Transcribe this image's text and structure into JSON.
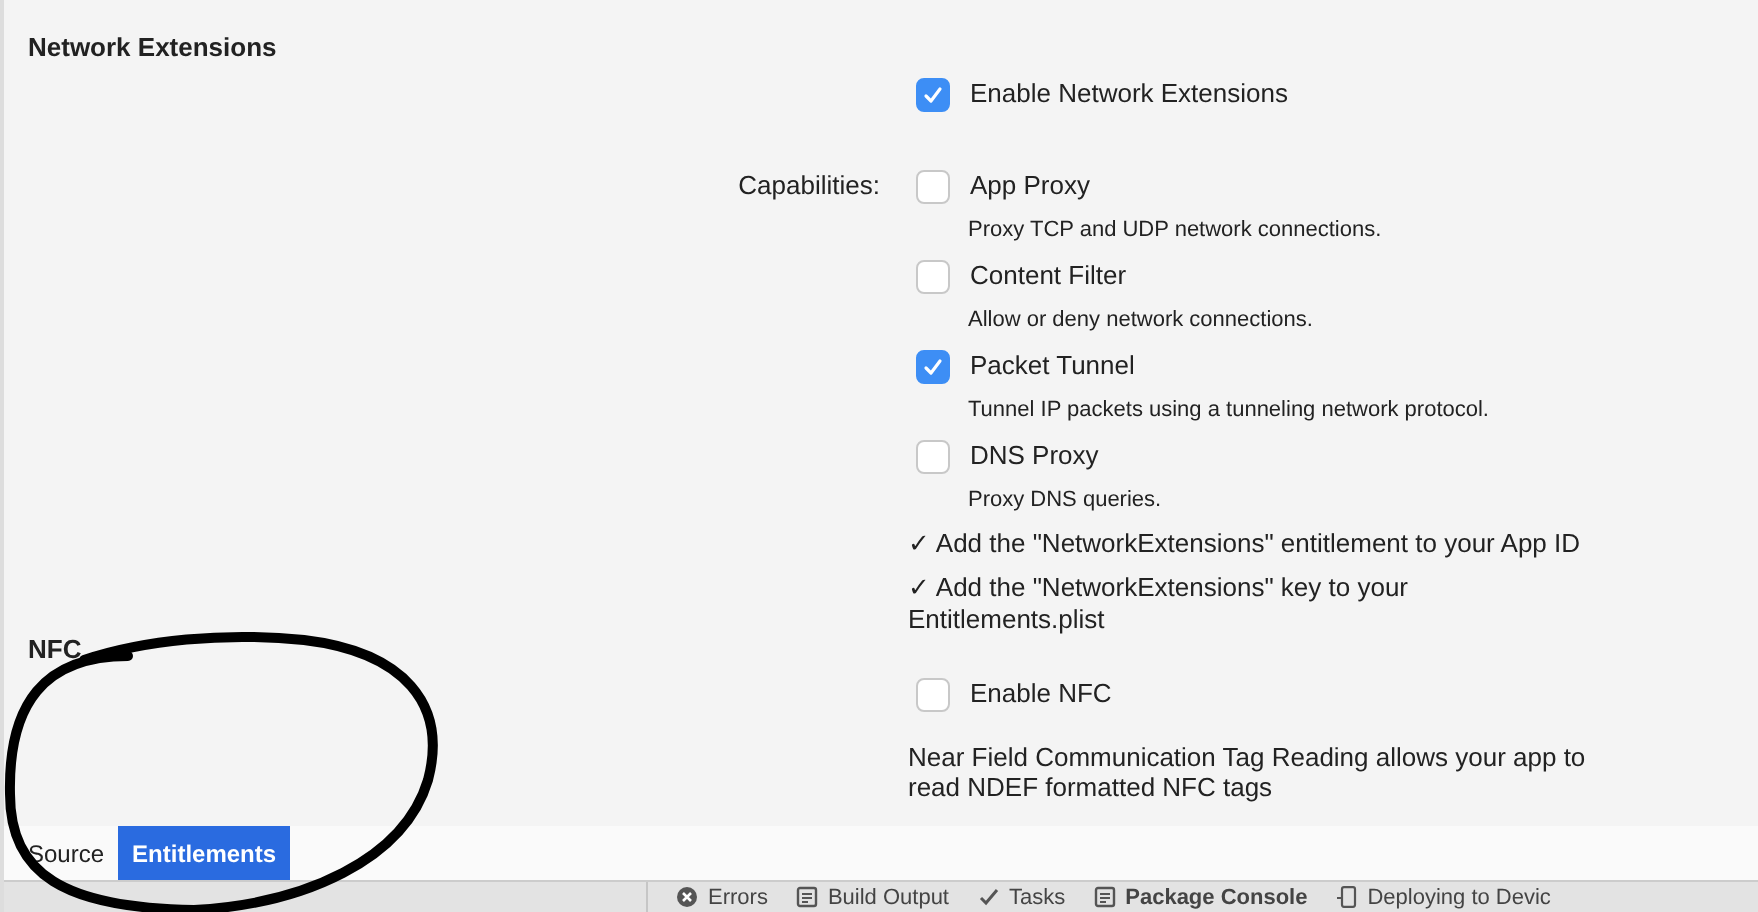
{
  "sections": [
    {
      "title": "Network Extensions",
      "items": [
        {
          "kind": "checkbox",
          "label": "Enable Network Extensions",
          "checked": true
        },
        {
          "kind": "checkbox",
          "caption": "Capabilities:",
          "label": "App Proxy",
          "checked": false,
          "description": "Proxy TCP and UDP network connections."
        },
        {
          "kind": "checkbox",
          "label": "Content Filter",
          "checked": false,
          "description": "Allow or deny network connections."
        },
        {
          "kind": "checkbox",
          "label": "Packet Tunnel",
          "checked": true,
          "description": "Tunnel IP packets using a tunneling network protocol."
        },
        {
          "kind": "checkbox",
          "label": "DNS Proxy",
          "checked": false,
          "description": "Proxy DNS queries."
        },
        {
          "kind": "note",
          "text": "✓ Add the \"NetworkExtensions\" entitlement to your App ID"
        },
        {
          "kind": "note",
          "text": "✓ Add the \"NetworkExtensions\" key to your Entitlements.plist"
        }
      ]
    },
    {
      "title": "NFC",
      "items": [
        {
          "kind": "checkbox",
          "label": "Enable NFC",
          "checked": false
        },
        {
          "kind": "info",
          "text": "Near Field Communication Tag Reading allows your app to read NDEF formatted NFC tags"
        }
      ]
    }
  ],
  "editor_tabs": [
    {
      "label": "Source",
      "selected": false
    },
    {
      "label": "Entitlements",
      "selected": true
    }
  ],
  "pads": [
    {
      "kind": "errors",
      "label": "Errors",
      "selected": false
    },
    {
      "kind": "output",
      "label": "Build Output",
      "selected": false
    },
    {
      "kind": "tasks",
      "label": "Tasks",
      "selected": false
    },
    {
      "kind": "output",
      "label": "Package Console",
      "selected": true
    },
    {
      "kind": "device",
      "label": "Deploying to Devic",
      "selected": false
    }
  ]
}
